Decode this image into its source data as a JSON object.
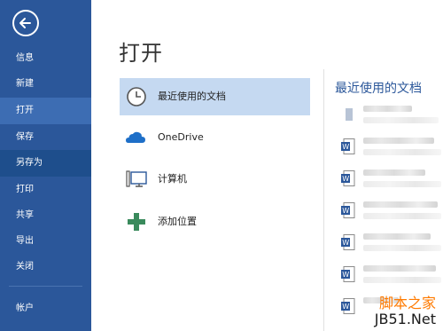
{
  "sidebar": {
    "items": [
      {
        "label": "信息"
      },
      {
        "label": "新建"
      },
      {
        "label": "打开"
      },
      {
        "label": "保存"
      },
      {
        "label": "另存为"
      },
      {
        "label": "打印"
      },
      {
        "label": "共享"
      },
      {
        "label": "导出"
      },
      {
        "label": "关闭"
      },
      {
        "label": "帐户"
      }
    ],
    "active_index": 2
  },
  "main": {
    "title": "打开",
    "places": [
      {
        "label": "最近使用的文档",
        "icon": "clock-icon"
      },
      {
        "label": "OneDrive",
        "icon": "cloud-icon"
      },
      {
        "label": "计算机",
        "icon": "computer-icon"
      },
      {
        "label": "添加位置",
        "icon": "plus-icon"
      }
    ]
  },
  "recent": {
    "title": "最近使用的文档"
  },
  "watermark": {
    "line1": "脚本之家",
    "line2": "JB51.Net"
  },
  "colors": {
    "sidebar": "#2b579a",
    "sidebar_active": "#3d6db3",
    "selected_place": "#c5d9f1",
    "accent": "#2b579a"
  }
}
